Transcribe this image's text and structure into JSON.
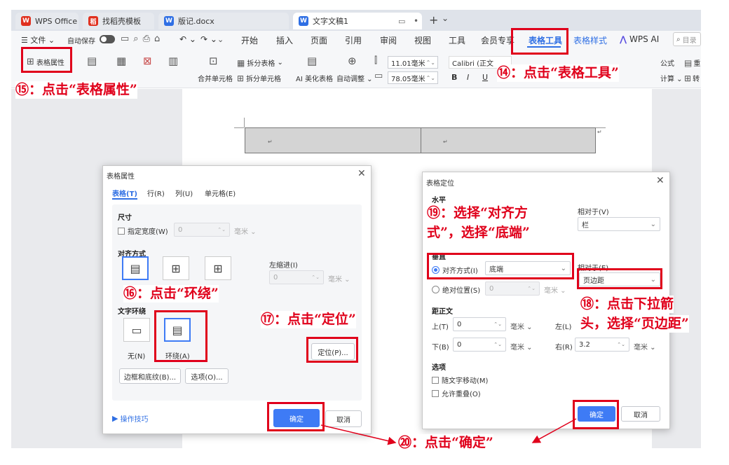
{
  "tabs": [
    {
      "label": "WPS Office",
      "icon": "W"
    },
    {
      "label": "找稻壳模板",
      "icon": "稻"
    },
    {
      "label": "版记.docx",
      "icon": "W"
    },
    {
      "label": "文字文稿1",
      "icon": "W"
    }
  ],
  "tab_controls": {
    "monitor": "▭",
    "dot": "•",
    "add": "+",
    "more": "⌄"
  },
  "menubar": {
    "file": "☰ 文件 ⌄",
    "autosave": "自动保存",
    "undo": "↶ ⌄",
    "redo": "↷ ⌄",
    "items": [
      "开始",
      "插入",
      "页面",
      "引用",
      "审阅",
      "视图",
      "工具",
      "会员专享",
      "表格工具",
      "表格样式",
      "WPS AI"
    ],
    "search_placeholder": "目录"
  },
  "ribbon": {
    "table_props": "表格属性",
    "split_table": "拆分表格",
    "merge_cells": "合并单元格",
    "split_cells": "拆分单元格",
    "ai_beautify": "AI 美化表格",
    "auto_fit": "自动调整",
    "height": "11.01毫米",
    "width": "78.05毫米",
    "font": "Calibri (正文",
    "bold": "B",
    "italic": "I",
    "underline": "U",
    "formula": "公式",
    "calc": "计算",
    "heavy": "重",
    "convert": "转"
  },
  "annotations": {
    "a14": "⑭：点击“表格工具”",
    "a15": "⑮：点击“表格属性”",
    "a16": "⑯：点击“环绕”",
    "a17": "⑰：点击“定位”",
    "a18_1": "⑱：点击下拉箭",
    "a18_2": "头，选择“页边距”",
    "a19_1": "⑲：选择“对齐方",
    "a19_2": "式”，选择“底端”",
    "a20": "⑳：点击“确定”"
  },
  "doc": {
    "cell_mark": "↵"
  },
  "props_dialog": {
    "title": "表格属性",
    "tabs": [
      "表格(T)",
      "行(R)",
      "列(U)",
      "单元格(E)"
    ],
    "size_heading": "尺寸",
    "specify_width": "指定宽度(W)",
    "width_value": "0",
    "width_unit": "毫米 ⌄",
    "align_heading": "对齐方式",
    "left_indent": "左缩进(I)",
    "indent_value": "0",
    "indent_unit": "毫米 ⌄",
    "wrap_heading": "文字环绕",
    "wrap_none": "无(N)",
    "wrap_around": "环绕(A)",
    "position_btn": "定位(P)...",
    "borders_btn": "边框和底纹(B)...",
    "options_btn": "选项(O)...",
    "tips": "操作技巧",
    "ok": "确定",
    "cancel": "取消"
  },
  "pos_dialog": {
    "title": "表格定位",
    "horizontal": "水平",
    "relative_to_h": "相对于(V)",
    "h_relative_value": "栏",
    "vertical": "垂直",
    "align_radio": "对齐方式(I)",
    "align_value": "底端",
    "relative_to_v": "相对于(E)",
    "v_relative_value": "页边距",
    "abs_radio": "绝对位置(S)",
    "abs_value": "0",
    "abs_unit": "毫米 ⌄",
    "distance_heading": "距正文",
    "top_label": "上(T)",
    "top_value": "0",
    "bottom_label": "下(B)",
    "bottom_value": "0",
    "left_label": "左(L)",
    "right_label": "右(R)",
    "right_value": "3.2",
    "unit": "毫米 ⌄",
    "options_heading": "选项",
    "move_with_text": "随文字移动(M)",
    "allow_overlap": "允许重叠(O)",
    "ok": "确定",
    "cancel": "取消"
  }
}
